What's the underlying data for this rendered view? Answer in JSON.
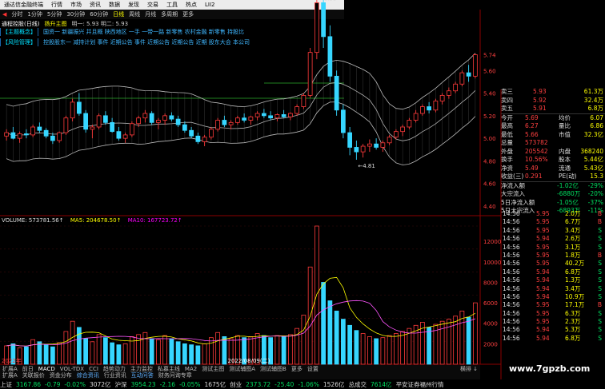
{
  "window": {
    "title": "通达信金融终端",
    "brand": "交易"
  },
  "menu": [
    "行情",
    "市场",
    "资讯",
    "数据",
    "发现",
    "交易",
    "工具",
    "热点",
    "LII2"
  ],
  "periods": [
    "分时",
    "1分钟",
    "5分钟",
    "30分钟",
    "60分钟",
    "日线",
    "周线",
    "月线",
    "多周期",
    "更多"
  ],
  "periods_selected": "日线",
  "title_row": [
    "通程控股(日线)",
    "扬升主图",
    "明一: 5.93 明二: 5.93"
  ],
  "banner1": {
    "tag": "【主题概念】",
    "text": "国资一 新疆振兴 并且概 陕西地区 一手 一带一路 新零售 农村金融 新零售 持股比"
  },
  "banner2": {
    "tag": "【风险管理】",
    "text": "控股股东一 减持计划 事件 近期公告 事件 近期公告 近期公告 近期 股东大会 本公司"
  },
  "price_labels": [
    "5.74",
    "5.60",
    "5.40",
    "5.20",
    "5.00",
    "4.80",
    "4.60",
    "4.40"
  ],
  "high_mark": "6.50",
  "low_mark": "4.81",
  "vol_header": {
    "volume": "VOLUME: 573781.56↑",
    "ma5": "MA5: 204678.50↑",
    "ma10": "MA10: 167723.72↑"
  },
  "vol_labels": [
    "12000",
    "10000",
    "8000",
    "6000",
    "4000",
    "2000"
  ],
  "date_labels": [
    "2022年",
    "2022/08/09(二)"
  ],
  "tabs1": [
    "扩展A",
    "前日",
    "MACD",
    "VOL-TDX",
    "CCI",
    "趋势动力",
    "主力监控",
    "私募主线",
    "MA2",
    "测试主图",
    "测试辅图A",
    "测试辅图B",
    "更多",
    "设置"
  ],
  "tabs2": [
    "扩展A",
    "关联报价",
    "资金分布",
    "综合资讯",
    "行业资讯",
    "互动问答",
    "财务问询专章"
  ],
  "tabs_right": [
    "横排",
    "↓"
  ],
  "quote": {
    "ask": [
      {
        "l": "卖三",
        "p": "5.93",
        "v": "61.3万"
      },
      {
        "l": "卖四",
        "p": "5.92",
        "v": "32.4万"
      },
      {
        "l": "卖五",
        "p": "5.91",
        "v": "6.8万"
      }
    ],
    "stats": [
      {
        "l1": "今开",
        "v1": "5.69",
        "l2": "均价",
        "v2": "6.07"
      },
      {
        "l1": "最高",
        "v1": "6.27",
        "l2": "量比",
        "v2": "6.86"
      },
      {
        "l1": "最低",
        "v1": "5.66",
        "l2": "市值",
        "v2": "32.3亿"
      },
      {
        "l1": "总量",
        "v1": "573782",
        "l2": "",
        "v2": ""
      },
      {
        "l1": "外盘",
        "v1": "205542",
        "l2": "内盘",
        "v2": "368240"
      },
      {
        "l1": "换手",
        "v1": "10.56%",
        "l2": "股本",
        "v2": "5.44亿"
      },
      {
        "l1": "净资",
        "v1": "5.49",
        "l2": "流通",
        "v2": "5.43亿"
      },
      {
        "l1": "收益(三)",
        "v1": "0.291",
        "l2": "PE(动)",
        "v2": "15.3"
      }
    ],
    "flows": [
      {
        "l": "净流入额",
        "v": "-1.02亿",
        "p": "-29%"
      },
      {
        "l": "大宗流入",
        "v": "-6880万",
        "p": "-20%"
      },
      {
        "l": "5日净流入额",
        "v": "-1.05亿",
        "p": "-37%"
      },
      {
        "l": "5日大宗流入",
        "v": "-6893万",
        "p": "-11%"
      }
    ]
  },
  "trades": [
    {
      "t": "14:56",
      "p": "5.95",
      "v": "2.0万",
      "f": "B"
    },
    {
      "t": "14:56",
      "p": "5.95",
      "v": "6.7万",
      "f": "B"
    },
    {
      "t": "14:56",
      "p": "5.95",
      "v": "3.4万",
      "f": "S"
    },
    {
      "t": "14:56",
      "p": "5.94",
      "v": "2.6万",
      "f": "S"
    },
    {
      "t": "14:56",
      "p": "5.95",
      "v": "3.1万",
      "f": "S"
    },
    {
      "t": "14:56",
      "p": "5.95",
      "v": "1.8万",
      "f": "B"
    },
    {
      "t": "14:56",
      "p": "5.95",
      "v": "40.2万",
      "f": "S"
    },
    {
      "t": "14:56",
      "p": "5.94",
      "v": "6.8万",
      "f": "S"
    },
    {
      "t": "14:56",
      "p": "5.94",
      "v": "1.3万",
      "f": "S"
    },
    {
      "t": "14:56",
      "p": "5.94",
      "v": "3.4万",
      "f": "S"
    },
    {
      "t": "14:56",
      "p": "5.94",
      "v": "10.9万",
      "f": "S"
    },
    {
      "t": "14:56",
      "p": "5.95",
      "v": "17.1万",
      "f": "B"
    },
    {
      "t": "14:56",
      "p": "5.95",
      "v": "6.3万",
      "f": "S"
    },
    {
      "t": "14:56",
      "p": "5.95",
      "v": "2.3万",
      "f": "S"
    },
    {
      "t": "14:56",
      "p": "5.94",
      "v": "5.3万",
      "f": "S"
    },
    {
      "t": "14:56",
      "p": "5.94",
      "v": "6.8万",
      "f": "S"
    }
  ],
  "status": [
    {
      "n": "上证",
      "v": "3167.86",
      "c": "-0.79",
      "r": "-0.02%",
      "a": "3072亿"
    },
    {
      "n": "沪深",
      "v": "3954.23",
      "c": "-2.16",
      "r": "-0.05%",
      "a": "1675亿"
    },
    {
      "n": "创业",
      "v": "2373.72",
      "c": "-25.40",
      "r": "-1.06%",
      "a": "1526亿"
    },
    {
      "n": "总成交",
      "v": "7614亿",
      "c": "",
      "r": "",
      "a": ""
    }
  ],
  "status_extra": "平安证券福州行情",
  "watermark": "www.7gpzb.com",
  "chart_data": {
    "type": "bar",
    "candles": [
      [
        5.02,
        5.08,
        4.98,
        5.05
      ],
      [
        5.05,
        5.1,
        4.99,
        5.0
      ],
      [
        5.0,
        5.06,
        4.96,
        5.04
      ],
      [
        5.04,
        5.08,
        5.0,
        5.03
      ],
      [
        5.03,
        5.12,
        5.01,
        5.1
      ],
      [
        5.1,
        5.14,
        5.05,
        5.07
      ],
      [
        5.07,
        5.09,
        5.0,
        5.02
      ],
      [
        5.02,
        5.05,
        4.95,
        4.98
      ],
      [
        4.98,
        5.06,
        4.96,
        5.05
      ],
      [
        5.05,
        5.2,
        5.03,
        5.18
      ],
      [
        5.18,
        5.35,
        5.15,
        5.32
      ],
      [
        5.32,
        5.4,
        5.2,
        5.22
      ],
      [
        5.22,
        5.25,
        5.05,
        5.08
      ],
      [
        5.08,
        5.12,
        5.0,
        5.1
      ],
      [
        5.1,
        5.22,
        5.08,
        5.2
      ],
      [
        5.2,
        5.24,
        5.12,
        5.14
      ],
      [
        5.14,
        5.18,
        5.05,
        5.06
      ],
      [
        5.06,
        5.1,
        4.98,
        5.0
      ],
      [
        5.0,
        5.05,
        4.96,
        5.03
      ],
      [
        5.03,
        5.15,
        5.01,
        5.13
      ],
      [
        5.13,
        5.2,
        5.1,
        5.18
      ],
      [
        5.18,
        5.25,
        5.14,
        5.22
      ],
      [
        5.22,
        5.24,
        5.12,
        5.14
      ],
      [
        5.14,
        5.18,
        5.08,
        5.16
      ],
      [
        5.16,
        5.22,
        5.12,
        5.2
      ],
      [
        5.2,
        5.23,
        5.15,
        5.17
      ],
      [
        5.17,
        5.2,
        5.1,
        5.12
      ],
      [
        5.12,
        5.15,
        5.05,
        5.07
      ],
      [
        5.07,
        5.1,
        5.0,
        5.02
      ],
      [
        5.02,
        5.05,
        4.95,
        4.97
      ],
      [
        4.97,
        5.03,
        4.93,
        5.01
      ],
      [
        5.01,
        5.1,
        4.99,
        5.08
      ],
      [
        5.08,
        5.18,
        5.06,
        5.16
      ],
      [
        5.16,
        5.2,
        5.1,
        5.12
      ],
      [
        5.12,
        5.16,
        5.08,
        5.14
      ],
      [
        5.14,
        5.2,
        5.12,
        5.18
      ],
      [
        5.18,
        5.22,
        5.14,
        5.16
      ],
      [
        5.16,
        5.2,
        5.12,
        5.19
      ],
      [
        5.19,
        5.24,
        5.16,
        5.22
      ],
      [
        5.22,
        5.26,
        5.18,
        5.2
      ],
      [
        5.2,
        5.24,
        5.16,
        5.18
      ],
      [
        5.18,
        5.22,
        5.15,
        5.21
      ],
      [
        5.21,
        5.25,
        5.18,
        5.19
      ],
      [
        5.19,
        5.23,
        5.16,
        5.22
      ],
      [
        5.22,
        5.3,
        5.2,
        5.28
      ],
      [
        5.28,
        5.4,
        5.26,
        5.38
      ],
      [
        5.38,
        5.8,
        5.36,
        5.76
      ],
      [
        5.76,
        6.5,
        5.7,
        6.2
      ],
      [
        6.2,
        6.3,
        5.8,
        5.9
      ],
      [
        5.9,
        6.0,
        5.5,
        5.55
      ],
      [
        5.55,
        5.6,
        5.2,
        5.25
      ],
      [
        5.25,
        5.3,
        5.0,
        5.05
      ],
      [
        5.05,
        5.1,
        4.85,
        4.92
      ],
      [
        4.92,
        4.98,
        4.81,
        4.88
      ],
      [
        4.88,
        4.95,
        4.83,
        4.93
      ],
      [
        4.93,
        4.99,
        4.88,
        4.95
      ],
      [
        4.95,
        5.0,
        4.9,
        4.92
      ],
      [
        4.92,
        4.98,
        4.88,
        4.96
      ],
      [
        4.96,
        5.03,
        4.94,
        5.01
      ],
      [
        5.01,
        5.08,
        4.99,
        5.06
      ],
      [
        5.06,
        5.12,
        5.02,
        5.1
      ],
      [
        5.1,
        5.18,
        5.08,
        5.16
      ],
      [
        5.16,
        5.25,
        5.14,
        5.22
      ],
      [
        5.22,
        5.3,
        5.2,
        5.28
      ],
      [
        5.28,
        5.32,
        5.22,
        5.25
      ],
      [
        5.25,
        5.35,
        5.23,
        5.33
      ],
      [
        5.33,
        5.4,
        5.3,
        5.38
      ],
      [
        5.38,
        5.45,
        5.35,
        5.42
      ],
      [
        5.42,
        5.5,
        5.4,
        5.48
      ],
      [
        5.48,
        5.6,
        5.46,
        5.58
      ],
      [
        5.58,
        5.65,
        5.5,
        5.55
      ],
      [
        5.55,
        5.75,
        5.53,
        5.74
      ]
    ],
    "volume": [
      1800,
      2000,
      1600,
      1700,
      2400,
      2200,
      1900,
      1700,
      2100,
      3200,
      4200,
      3600,
      2500,
      2200,
      2900,
      2600,
      2100,
      1900,
      2000,
      2700,
      2900,
      3100,
      2500,
      2400,
      2800,
      2500,
      2200,
      2000,
      1900,
      1800,
      2000,
      2600,
      3100,
      2700,
      2500,
      2800,
      2600,
      2700,
      3000,
      2800,
      2600,
      2800,
      2700,
      2900,
      3500,
      4800,
      9500,
      13500,
      8000,
      6200,
      5200,
      4400,
      3800,
      3300,
      3000,
      2700,
      2500,
      2600,
      2800,
      3000,
      3200,
      3500,
      3800,
      4100,
      3600,
      3900,
      4200,
      4400,
      4700,
      5200,
      4600,
      6000
    ],
    "ylim": [
      4.4,
      5.8
    ],
    "vol_ylim": [
      0,
      13500
    ]
  }
}
